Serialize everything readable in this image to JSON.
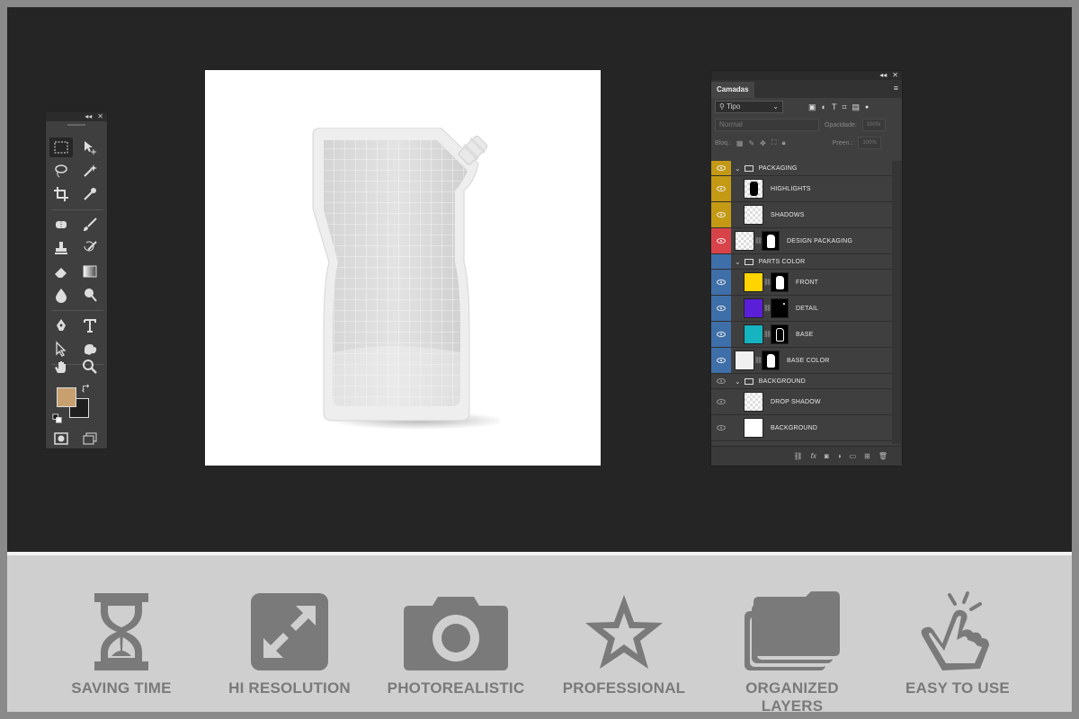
{
  "layers_panel": {
    "tab": "Camadas",
    "filter_placeholder": "Tipo",
    "blend_mode": "Normal",
    "opacity_label": "Opacidade:",
    "opacity_value": "100%",
    "lock_label": "Bloq.:",
    "fill_label": "Preen.:",
    "fill_value": "100%",
    "rows": [
      {
        "kind": "group",
        "name": "PACKAGING",
        "color": "#c49a14"
      },
      {
        "kind": "layer",
        "name": "HIGHLIGHTS",
        "color": "#c49a14",
        "thumb": "check-mask"
      },
      {
        "kind": "layer",
        "name": "SHADOWS",
        "color": "#c49a14",
        "thumb": "check"
      },
      {
        "kind": "layer",
        "name": "DESIGN PACKAGING",
        "color": "#d8434a",
        "thumb": "smart"
      },
      {
        "kind": "group",
        "name": "PARTS COLOR",
        "color": "#3f6fa8"
      },
      {
        "kind": "layer",
        "name": "FRONT",
        "color": "#3f6fa8",
        "fill": "#ffd400"
      },
      {
        "kind": "layer",
        "name": "DETAIL",
        "color": "#3f6fa8",
        "fill": "#5b1fd8"
      },
      {
        "kind": "layer",
        "name": "BASE",
        "color": "#3f6fa8",
        "fill": "#16b3c0"
      },
      {
        "kind": "layer",
        "name": "BASE COLOR",
        "color": "#3f6fa8",
        "fill": "#f0f0f0"
      },
      {
        "kind": "group",
        "name": "BACKGROUND",
        "color": ""
      },
      {
        "kind": "layer",
        "name": "DROP SHADOW",
        "color": "",
        "thumb": "check"
      },
      {
        "kind": "layer",
        "name": "BACKGROUND",
        "color": "",
        "fill": "#ffffff"
      }
    ]
  },
  "features": [
    {
      "label": "SAVING TIME",
      "icon": "hourglass-icon"
    },
    {
      "label": "HI RESOLUTION",
      "icon": "expand-icon"
    },
    {
      "label": "PHOTOREALISTIC",
      "icon": "camera-icon"
    },
    {
      "label": "PROFESSIONAL",
      "icon": "star-icon"
    },
    {
      "label": "ORGANIZED LAYERS",
      "icon": "layers-icon"
    },
    {
      "label": "EASY TO USE",
      "icon": "tap-hand-icon"
    }
  ],
  "colors": {
    "foreground": "#c8a070",
    "background": "#1f1f1f",
    "feature_icon": "#7a7a7a"
  }
}
